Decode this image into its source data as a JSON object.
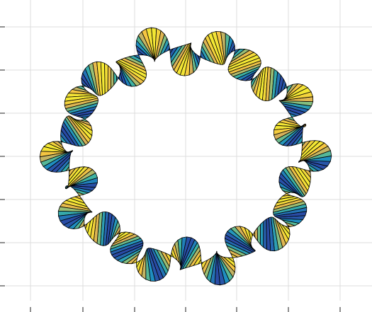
{
  "chart_data": {
    "type": "surface",
    "title": "",
    "xlabel": "",
    "ylabel": "",
    "shape": "twisted-ribbon-torus",
    "ring_lobes": 10,
    "ribbon_twists": 24,
    "xlim": [
      -1.35,
      1.6
    ],
    "ylim": [
      -1.45,
      1.45
    ],
    "grid": true,
    "colormap": [
      "#2a4aa4",
      "#1f8fc0",
      "#3fb3a3",
      "#8fc07a",
      "#d6b05a",
      "#f5c542",
      "#f3e934"
    ],
    "edge_color": "#000000"
  }
}
